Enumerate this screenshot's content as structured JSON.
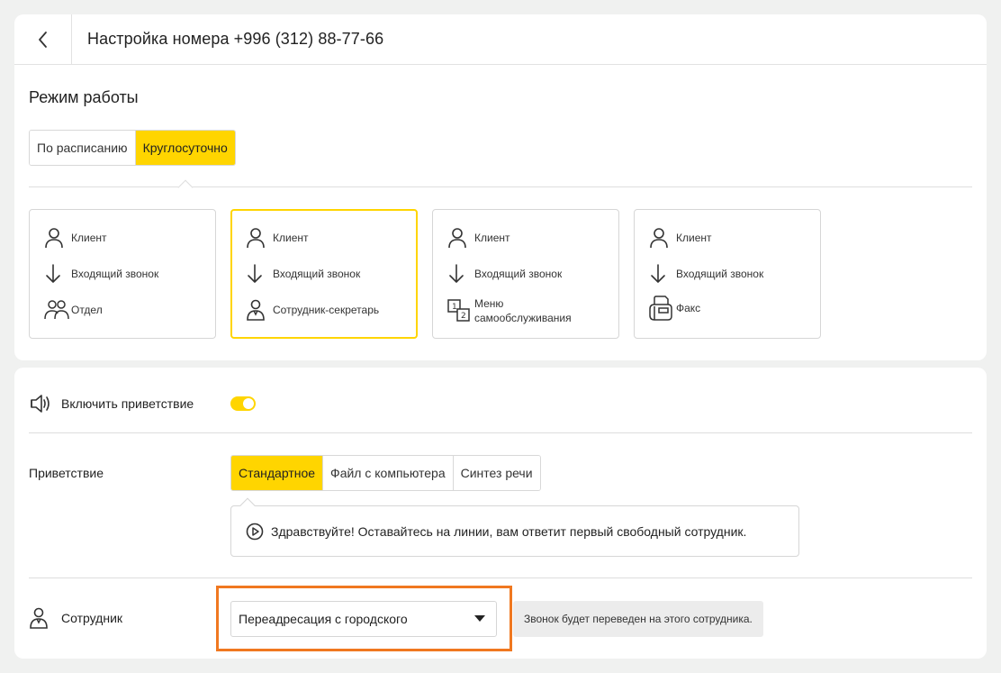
{
  "header": {
    "title": "Настройка номера +996 (312) 88-77-66"
  },
  "work_mode": {
    "title": "Режим работы",
    "options": [
      "По расписанию",
      "Круглосуточно"
    ],
    "selected": "Круглосуточно"
  },
  "schemes": [
    {
      "rows": [
        {
          "icon": "person-icon",
          "label": "Клиент"
        },
        {
          "icon": "arrow-down-icon",
          "label": "Входящий звонок"
        },
        {
          "icon": "group-icon",
          "label": "Отдел"
        }
      ]
    },
    {
      "selected": true,
      "rows": [
        {
          "icon": "person-icon",
          "label": "Клиент"
        },
        {
          "icon": "arrow-down-icon",
          "label": "Входящий звонок"
        },
        {
          "icon": "secretary-icon",
          "label": "Сотрудник-секретарь"
        }
      ]
    },
    {
      "rows": [
        {
          "icon": "person-icon",
          "label": "Клиент"
        },
        {
          "icon": "arrow-down-icon",
          "label": "Входящий звонок"
        },
        {
          "icon": "ivr-menu-icon",
          "label": "Меню самообслуживания"
        }
      ]
    },
    {
      "rows": [
        {
          "icon": "person-icon",
          "label": "Клиент"
        },
        {
          "icon": "arrow-down-icon",
          "label": "Входящий звонок"
        },
        {
          "icon": "fax-icon",
          "label": "Факс"
        }
      ]
    }
  ],
  "greeting": {
    "toggle_label": "Включить приветствие",
    "enabled": true,
    "label": "Приветствие",
    "options": [
      "Стандартное",
      "Файл с компьютера",
      "Синтез речи"
    ],
    "selected": "Стандартное",
    "message": "Здравствуйте! Оставайтесь на линии, вам ответит первый свободный сотрудник."
  },
  "employee": {
    "label": "Сотрудник",
    "select_value": "Переадресация с городского",
    "hint": "Звонок будет переведен на этого сотрудника."
  },
  "colors": {
    "accent": "#ffd500",
    "highlight": "#f07820"
  }
}
